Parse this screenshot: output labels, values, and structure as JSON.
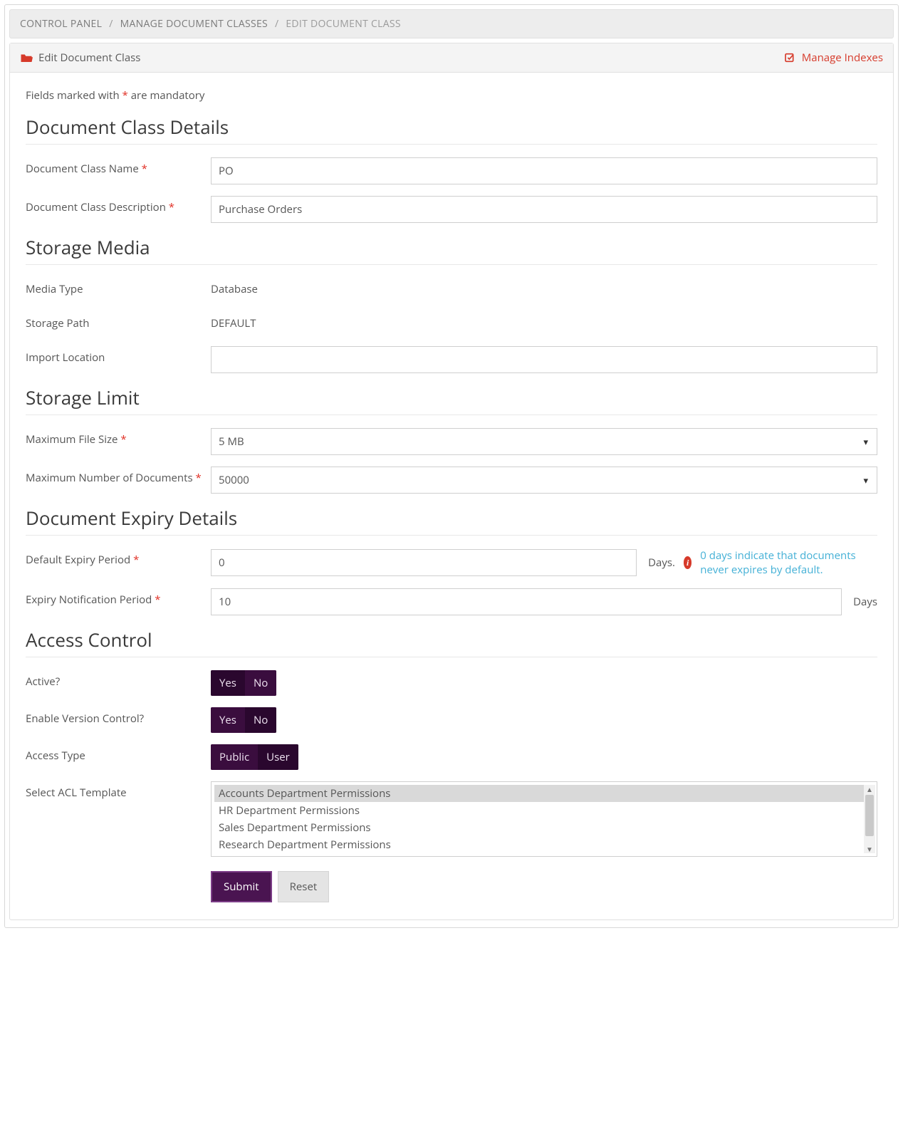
{
  "breadcrumb": {
    "items": [
      "CONTROL PANEL",
      "MANAGE DOCUMENT CLASSES",
      "EDIT DOCUMENT CLASS"
    ]
  },
  "panel": {
    "title": "Edit Document Class",
    "manage_indexes": "Manage Indexes"
  },
  "mandatory_note_pre": "Fields marked with ",
  "mandatory_note_post": " are mandatory",
  "sections": {
    "details": "Document Class Details",
    "storage_media": "Storage Media",
    "storage_limit": "Storage Limit",
    "expiry": "Document Expiry Details",
    "access": "Access Control"
  },
  "labels": {
    "class_name": "Document Class Name ",
    "class_desc": "Document Class Description ",
    "media_type": "Media Type",
    "storage_path": "Storage Path",
    "import_location": "Import Location",
    "max_file_size": "Maximum File Size ",
    "max_docs": "Maximum Number of Documents ",
    "default_expiry": "Default Expiry Period ",
    "expiry_notif": "Expiry Notification Period ",
    "active": "Active?",
    "version_control": "Enable Version Control?",
    "access_type": "Access Type",
    "acl_template": "Select ACL Template"
  },
  "values": {
    "class_name": "PO",
    "class_desc": "Purchase Orders",
    "media_type": "Database",
    "storage_path": "DEFAULT",
    "import_location": "",
    "max_file_size": "5 MB",
    "max_docs": "50000",
    "default_expiry": "0",
    "expiry_notif": "10"
  },
  "suffix_days": "Days.",
  "suffix_days2": "Days",
  "hint_expiry": "0 days indicate that documents never expires by default.",
  "toggles": {
    "yes": "Yes",
    "no": "No",
    "public": "Public",
    "user": "User"
  },
  "acl_options": [
    "Accounts Department Permissions",
    "HR Department Permissions",
    "Sales Department Permissions",
    "Research Department Permissions"
  ],
  "actions": {
    "submit": "Submit",
    "reset": "Reset"
  }
}
